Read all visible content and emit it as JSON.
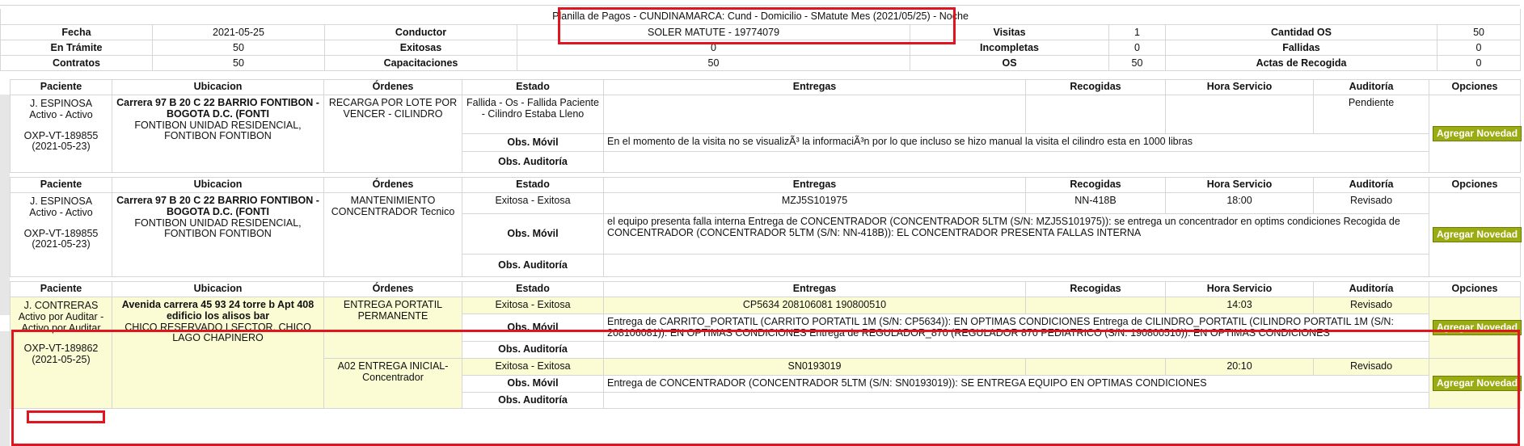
{
  "summary": {
    "title": "Planilla de Pagos - CUNDINAMARCA: Cund - Domicilio - SMatute Mes (2021/05/25) - Noche",
    "rows": [
      [
        {
          "l": "Fecha"
        },
        {
          "v": "2021-05-25"
        },
        {
          "l": "Conductor"
        },
        {
          "v": "SOLER MATUTE - 19774079"
        },
        {
          "l": "Visitas"
        },
        {
          "v": "1"
        },
        {
          "l": "Cantidad OS"
        },
        {
          "v": "50"
        }
      ],
      [
        {
          "l": "En Trámite"
        },
        {
          "v": "50"
        },
        {
          "l": "Exitosas"
        },
        {
          "v": "0"
        },
        {
          "l": "Incompletas"
        },
        {
          "v": "0"
        },
        {
          "l": "Fallidas"
        },
        {
          "v": "0"
        }
      ],
      [
        {
          "l": "Contratos"
        },
        {
          "v": "50"
        },
        {
          "l": "Capacitaciones"
        },
        {
          "v": "50"
        },
        {
          "l": "OS"
        },
        {
          "v": "50"
        },
        {
          "l": "Actas de Recogida"
        },
        {
          "v": "0"
        }
      ]
    ]
  },
  "columns": [
    "Paciente",
    "Ubicacion",
    "Órdenes",
    "Estado",
    "Entregas",
    "Recogidas",
    "Hora Servicio",
    "Auditoría",
    "Opciones"
  ],
  "obs_movil_label": "Obs. Móvil",
  "obs_auditoria_label": "Obs. Auditoría",
  "add_button_label": "Agregar Novedad",
  "records": [
    {
      "patient": {
        "name": "J. ESPINOSA",
        "status": "Activo - Activo",
        "code": "OXP-VT-189855 (2021-05-23)"
      },
      "location": {
        "address": "Carrera 97 B 20 C 22 BARRIO FONTIBON - BOGOTA D.C. (FONTI",
        "area": "FONTIBON UNIDAD RESIDENCIAL, FONTIBON FONTIBON"
      },
      "orders": [
        {
          "order": "RECARGA POR LOTE POR VENCER - CILINDRO",
          "estado": "Fallida - Os - Fallida Paciente - Cilindro Estaba Lleno",
          "entregas": "",
          "recogidas": "",
          "hora": "",
          "auditoria": "Pendiente",
          "obs_movil": "En el momento de la visita no se visualizÃ³ la informaciÃ³n por lo que incluso se hizo manual la visita el cilindro esta en 1000 libras",
          "obs_auditoria": ""
        }
      ]
    },
    {
      "patient": {
        "name": "J. ESPINOSA",
        "status": "Activo - Activo",
        "code": "OXP-VT-189855 (2021-05-23)"
      },
      "location": {
        "address": "Carrera 97 B 20 C 22 BARRIO FONTIBON - BOGOTA D.C. (FONTI",
        "area": "FONTIBON UNIDAD RESIDENCIAL, FONTIBON FONTIBON"
      },
      "orders": [
        {
          "order": "MANTENIMIENTO CONCENTRADOR Tecnico",
          "estado": "Exitosa - Exitosa",
          "entregas": "MZJ5S101975",
          "recogidas": "NN-418B",
          "hora": "18:00",
          "auditoria": "Revisado",
          "obs_movil": "el equipo presenta falla interna Entrega de CONCENTRADOR (CONCENTRADOR 5LTM (S/N: MZJ5S101975)): se entrega un concentrador en optims condiciones Recogida de CONCENTRADOR (CONCENTRADOR 5LTM (S/N: NN-418B)): EL CONCENTRADOR PRESENTA FALLAS INTERNA",
          "obs_auditoria": ""
        }
      ]
    },
    {
      "patient": {
        "name": "J. CONTRERAS",
        "status": "Activo por Auditar - Activo por Auditar",
        "code": "OXP-VT-189862 (2021-05-25)"
      },
      "location": {
        "address": "Avenida carrera 45 93 24 torre b Apt 408 edificio los alisos bar",
        "area": "CHICO RESERVADO I SECTOR, CHICO LAGO CHAPINERO"
      },
      "orders": [
        {
          "order": "ENTREGA PORTATIL PERMANENTE",
          "estado": "Exitosa - Exitosa",
          "entregas": "CP5634 208106081 190800510",
          "recogidas": "",
          "hora": "14:03",
          "auditoria": "Revisado",
          "obs_movil": "Entrega de CARRITO_PORTATIL (CARRITO PORTATIL 1M (S/N: CP5634)): EN OPTIMAS CONDICIONES Entrega de CILINDRO_PORTATIL (CILINDRO PORTATIL 1M (S/N: 208106081)): EN OPTIMAS CONDICIONES Entrega de REGULADOR_870 (REGULADOR 870 PEDIATRICO (S/N: 190800510)): EN OPTIMAS CONDICIONES",
          "obs_auditoria": ""
        },
        {
          "order": "A02 ENTREGA INICIAL-Concentrador",
          "estado": "Exitosa - Exitosa",
          "entregas": "SN0193019",
          "recogidas": "",
          "hora": "20:10",
          "auditoria": "Revisado",
          "obs_movil": "Entrega de CONCENTRADOR (CONCENTRADOR 5LTM (S/N: SN0193019)): SE ENTREGA EQUIPO EN OPTIMAS CONDICIONES",
          "obs_auditoria": ""
        }
      ]
    }
  ]
}
